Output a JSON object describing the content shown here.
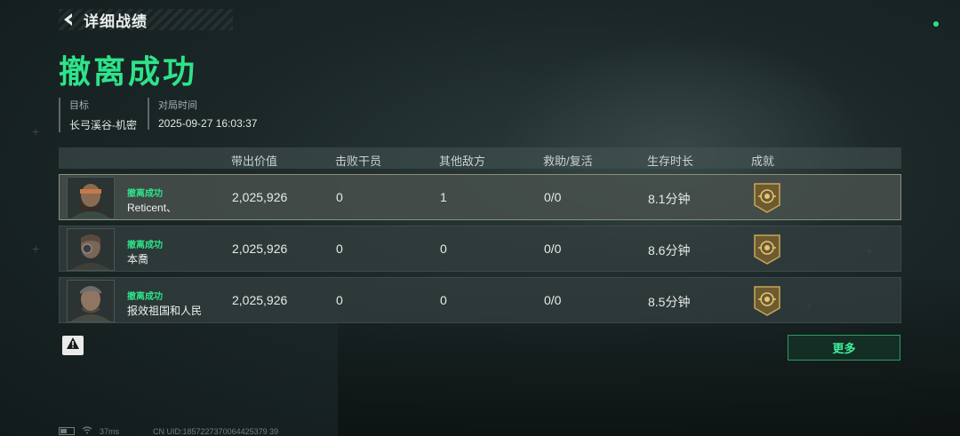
{
  "header": {
    "title": "详细战绩"
  },
  "result": {
    "title": "撤离成功"
  },
  "info": {
    "target_label": "目标",
    "target_value": "长弓溪谷-机密",
    "time_label": "对局时间",
    "time_value": "2025-09-27 16:03:37"
  },
  "table": {
    "headers": [
      "带出价值",
      "击败干员",
      "其他敌方",
      "救助/复活",
      "生存时长",
      "成就"
    ],
    "rows": [
      {
        "status": "撤离成功",
        "name": "Reticent、",
        "value": "2,025,926",
        "kills": "0",
        "others": "1",
        "assist": "0/0",
        "survival": "8.1分钟",
        "achievement_icon": "shield-badge-icon"
      },
      {
        "status": "撤离成功",
        "name": "本喬",
        "value": "2,025,926",
        "kills": "0",
        "others": "0",
        "assist": "0/0",
        "survival": "8.6分钟",
        "achievement_icon": "shield-badge-icon"
      },
      {
        "status": "撤离成功",
        "name": "报效祖国和人民",
        "value": "2,025,926",
        "kills": "0",
        "others": "0",
        "assist": "0/0",
        "survival": "8.5分钟",
        "achievement_icon": "shield-badge-icon"
      }
    ]
  },
  "buttons": {
    "more": "更多"
  },
  "footer": {
    "ping": "37ms",
    "uid": "CN UID:1857227370064425379 39"
  },
  "colors": {
    "accent_green": "#2ee38a",
    "badge_gold": "#b89a55"
  }
}
